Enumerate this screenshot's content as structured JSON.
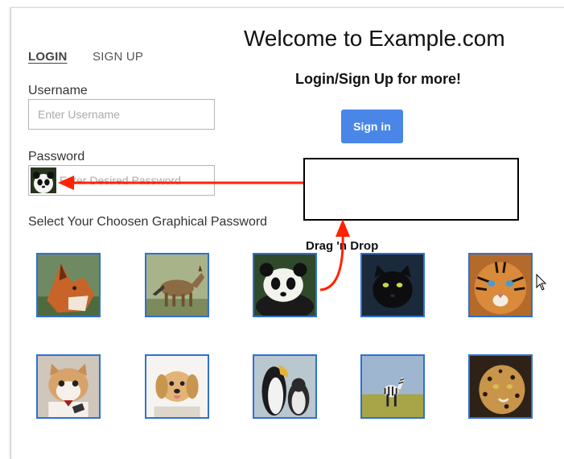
{
  "tabs": {
    "login": "LOGIN",
    "signup": "SIGN UP"
  },
  "login_form": {
    "username_label": "Username",
    "username_placeholder": "Enter Username",
    "password_label": "Password",
    "password_placeholder": "Enter Desired Password",
    "graphical_label": "Select Your Choosen Graphical Password"
  },
  "hero": {
    "welcome": "Welcome to Example.com",
    "subtitle": "Login/Sign Up for more!",
    "signin_label": "Sign in"
  },
  "drag_label": "Drag 'n Drop",
  "images": [
    {
      "animal": "fox"
    },
    {
      "animal": "jackal"
    },
    {
      "animal": "panda"
    },
    {
      "animal": "black-panther"
    },
    {
      "animal": "tiger"
    },
    {
      "animal": "cat"
    },
    {
      "animal": "puppy"
    },
    {
      "animal": "penguins"
    },
    {
      "animal": "zebra"
    },
    {
      "animal": "leopard"
    }
  ],
  "colors": {
    "accent_blue": "#4a86e8",
    "tile_border": "#2f6fd6",
    "arrow_red": "#ff2200"
  }
}
